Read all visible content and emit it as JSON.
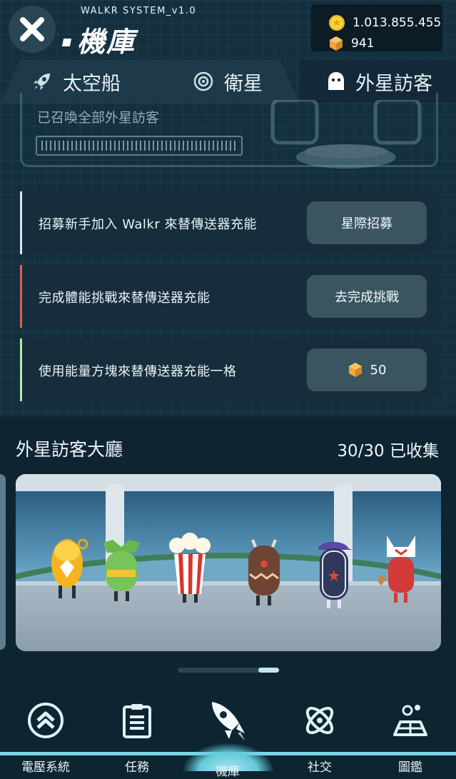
{
  "header": {
    "system_label": "WALKR SYSTEM_v1.0",
    "title": "機庫",
    "coins": "1.013.855.455",
    "cubes": "941",
    "close_icon": "close-icon"
  },
  "tabs": [
    {
      "label": "太空船",
      "icon": "rocket-icon"
    },
    {
      "label": "衛星",
      "icon": "satellite-icon"
    },
    {
      "label": "外星訪客",
      "icon": "ghost-icon",
      "active": true
    }
  ],
  "charge": {
    "summon_text": "已召喚全部外星訪客",
    "progress": 1.0
  },
  "tasks": [
    {
      "label": "招募新手加入 Walkr 來替傳送器充能",
      "button": "星際招募",
      "accent": "#cfe7ee"
    },
    {
      "label": "完成體能挑戰來替傳送器充能",
      "button": "去完成挑戰",
      "accent": "#e0604e"
    },
    {
      "label": "使用能量方塊來替傳送器充能一格",
      "button": "50",
      "accent": "#b8e7a6"
    }
  ],
  "lounge": {
    "title": "外星訪客大廳",
    "count": "30/30 已收集"
  },
  "nav": [
    {
      "label": "電壓系統",
      "icon": "chevron-up-icon"
    },
    {
      "label": "任務",
      "icon": "clipboard-icon"
    },
    {
      "label": "機庫",
      "icon": "rocket-icon",
      "active": true
    },
    {
      "label": "社交",
      "icon": "atom-icon"
    },
    {
      "label": "圖鑑",
      "icon": "planet-map-icon"
    }
  ],
  "colors": {
    "background": "#14303f",
    "accent": "#78d8e8"
  }
}
